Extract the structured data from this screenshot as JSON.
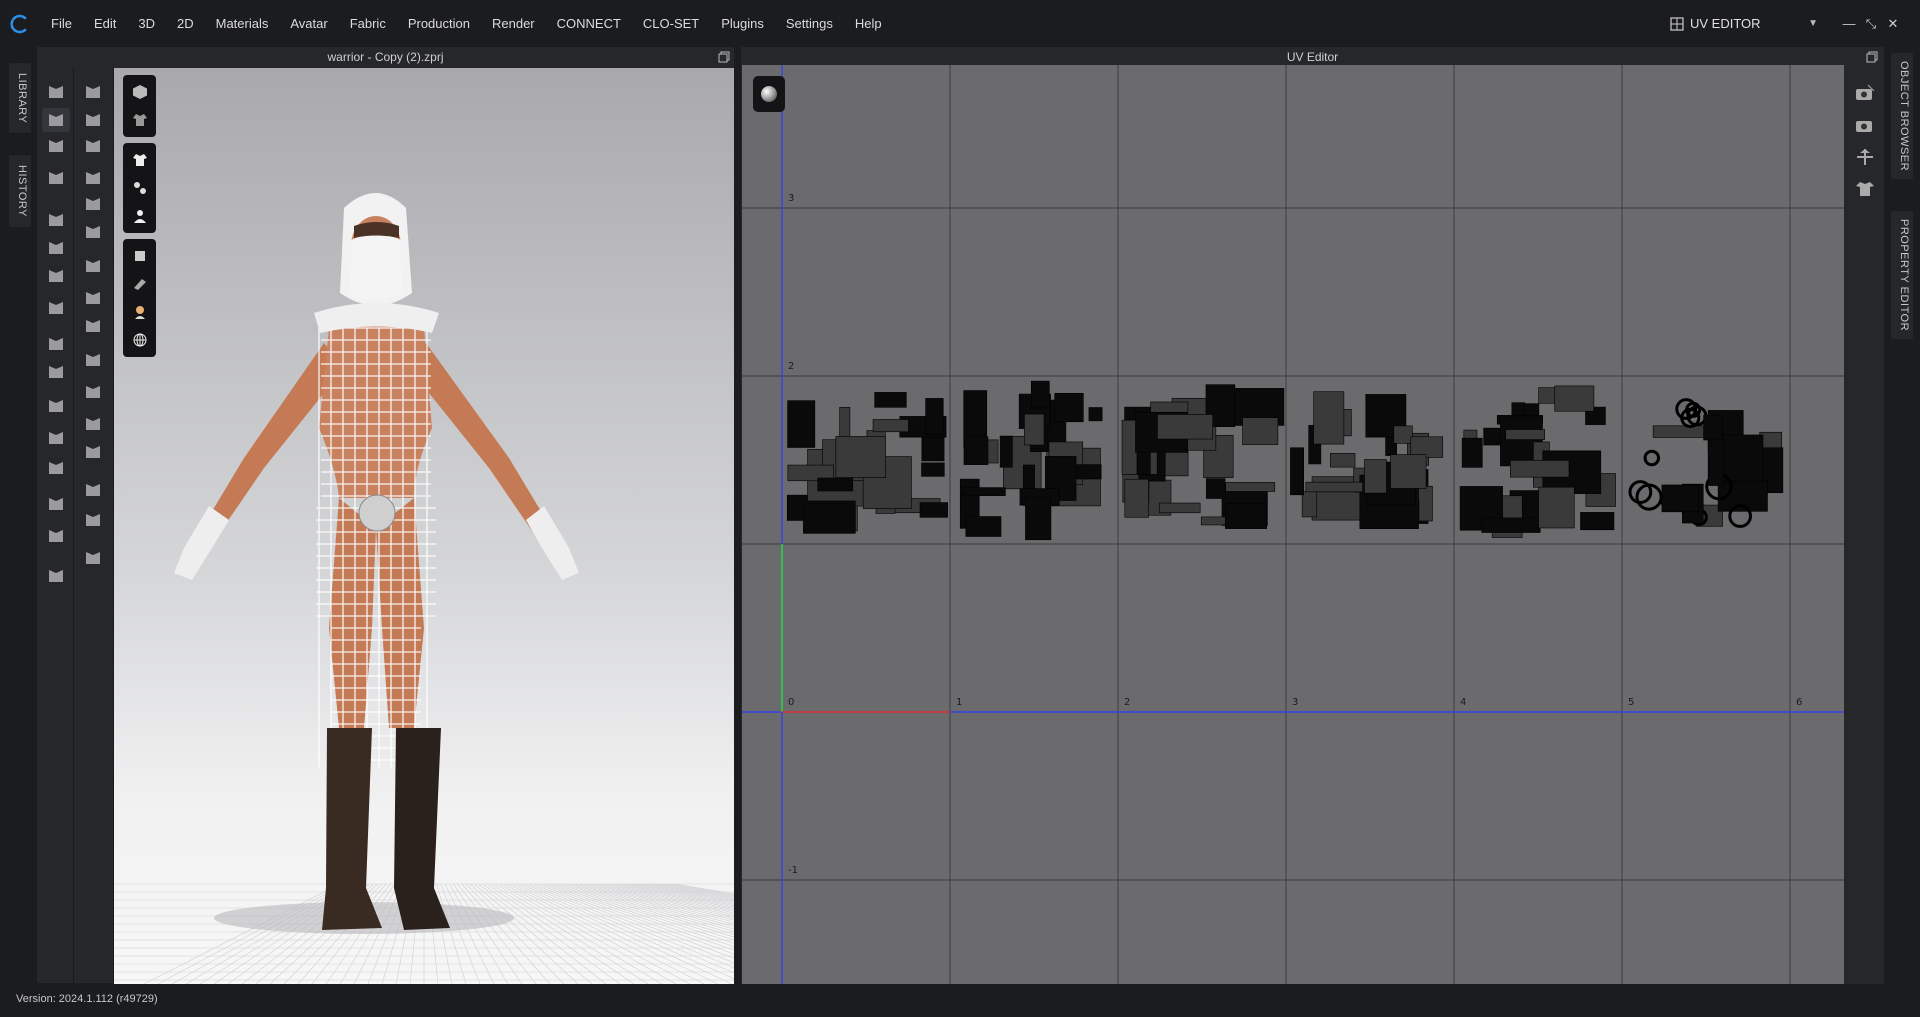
{
  "app": {
    "menus": [
      "File",
      "Edit",
      "3D",
      "2D",
      "Materials",
      "Avatar",
      "Fabric",
      "Production",
      "Render",
      "CONNECT",
      "CLO-SET",
      "Plugins",
      "Settings",
      "Help"
    ],
    "mode": "UV EDITOR",
    "version": "Version: 2024.1.112 (r49729)"
  },
  "left_rail": {
    "tabs": [
      "LIBRARY",
      "HISTORY"
    ]
  },
  "right_rail": {
    "tabs": [
      "OBJECT BROWSER",
      "PROPERTY EDITOR"
    ]
  },
  "window_3d": {
    "title": "warrior - Copy (2).zprj"
  },
  "window_uv": {
    "title": "UV Editor",
    "x_axis_labels": [
      "0",
      "1",
      "2",
      "3",
      "4",
      "5",
      "6"
    ],
    "y_axis_labels": [
      "3",
      "2",
      "-1"
    ]
  },
  "colors": {
    "background": "#1b1c1f",
    "panel": "#26272b",
    "uv_canvas": "#6b6b6d",
    "u_axis": "#e0332c",
    "v_axis": "#2fd23a",
    "origin_lines": "#2a3bff",
    "logo": "#2e8fe8"
  }
}
